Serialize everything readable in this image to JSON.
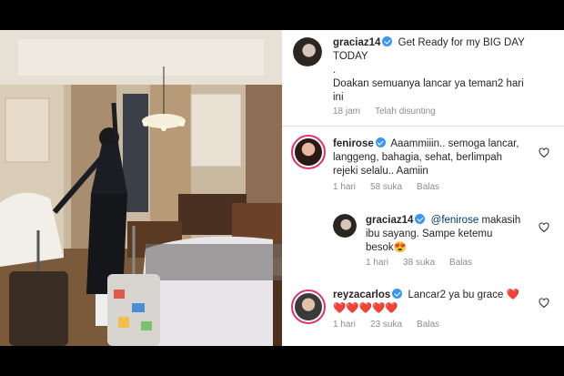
{
  "post": {
    "username": "graciaz14",
    "caption_line1": "Get Ready for my BIG DAY",
    "caption_line2": "TODAY",
    "caption_dot": ".",
    "caption_line3": "Doakan semuanya lancar ya teman2 hari",
    "caption_line4": "ini",
    "time": "18 jam",
    "edited": "Telah disunting"
  },
  "comments": [
    {
      "username": "fenirose",
      "text_line1": "Aaammiiin.. semoga lancar,",
      "text_line2": "langgeng, bahagia, sehat, berlimpah",
      "text_line3": "rejeki selalu.. Aamiin",
      "time": "1 hari",
      "likes": "58 suka",
      "reply": "Balas"
    },
    {
      "username": "graciaz14",
      "mention": "@fenirose",
      "text_line1": "makasih",
      "text_line2": "ibu sayang. Sampe ketemu",
      "text_line3": "besok😍",
      "time": "1 hari",
      "likes": "38 suka",
      "reply": "Balas"
    },
    {
      "username": "reyzacarlos",
      "text_line1": "Lancar2 ya bu grace ❤️",
      "text_line2": "❤️❤️❤️❤️❤️",
      "time": "1 hari",
      "likes": "23 suka",
      "reply": "Balas"
    }
  ],
  "colors": {
    "verified": "#3897f0",
    "story_ring": "#e1306c",
    "meta_text": "#8e8e8e",
    "mention": "#00376b"
  },
  "icons": [
    "verified-badge-icon",
    "heart-icon"
  ]
}
